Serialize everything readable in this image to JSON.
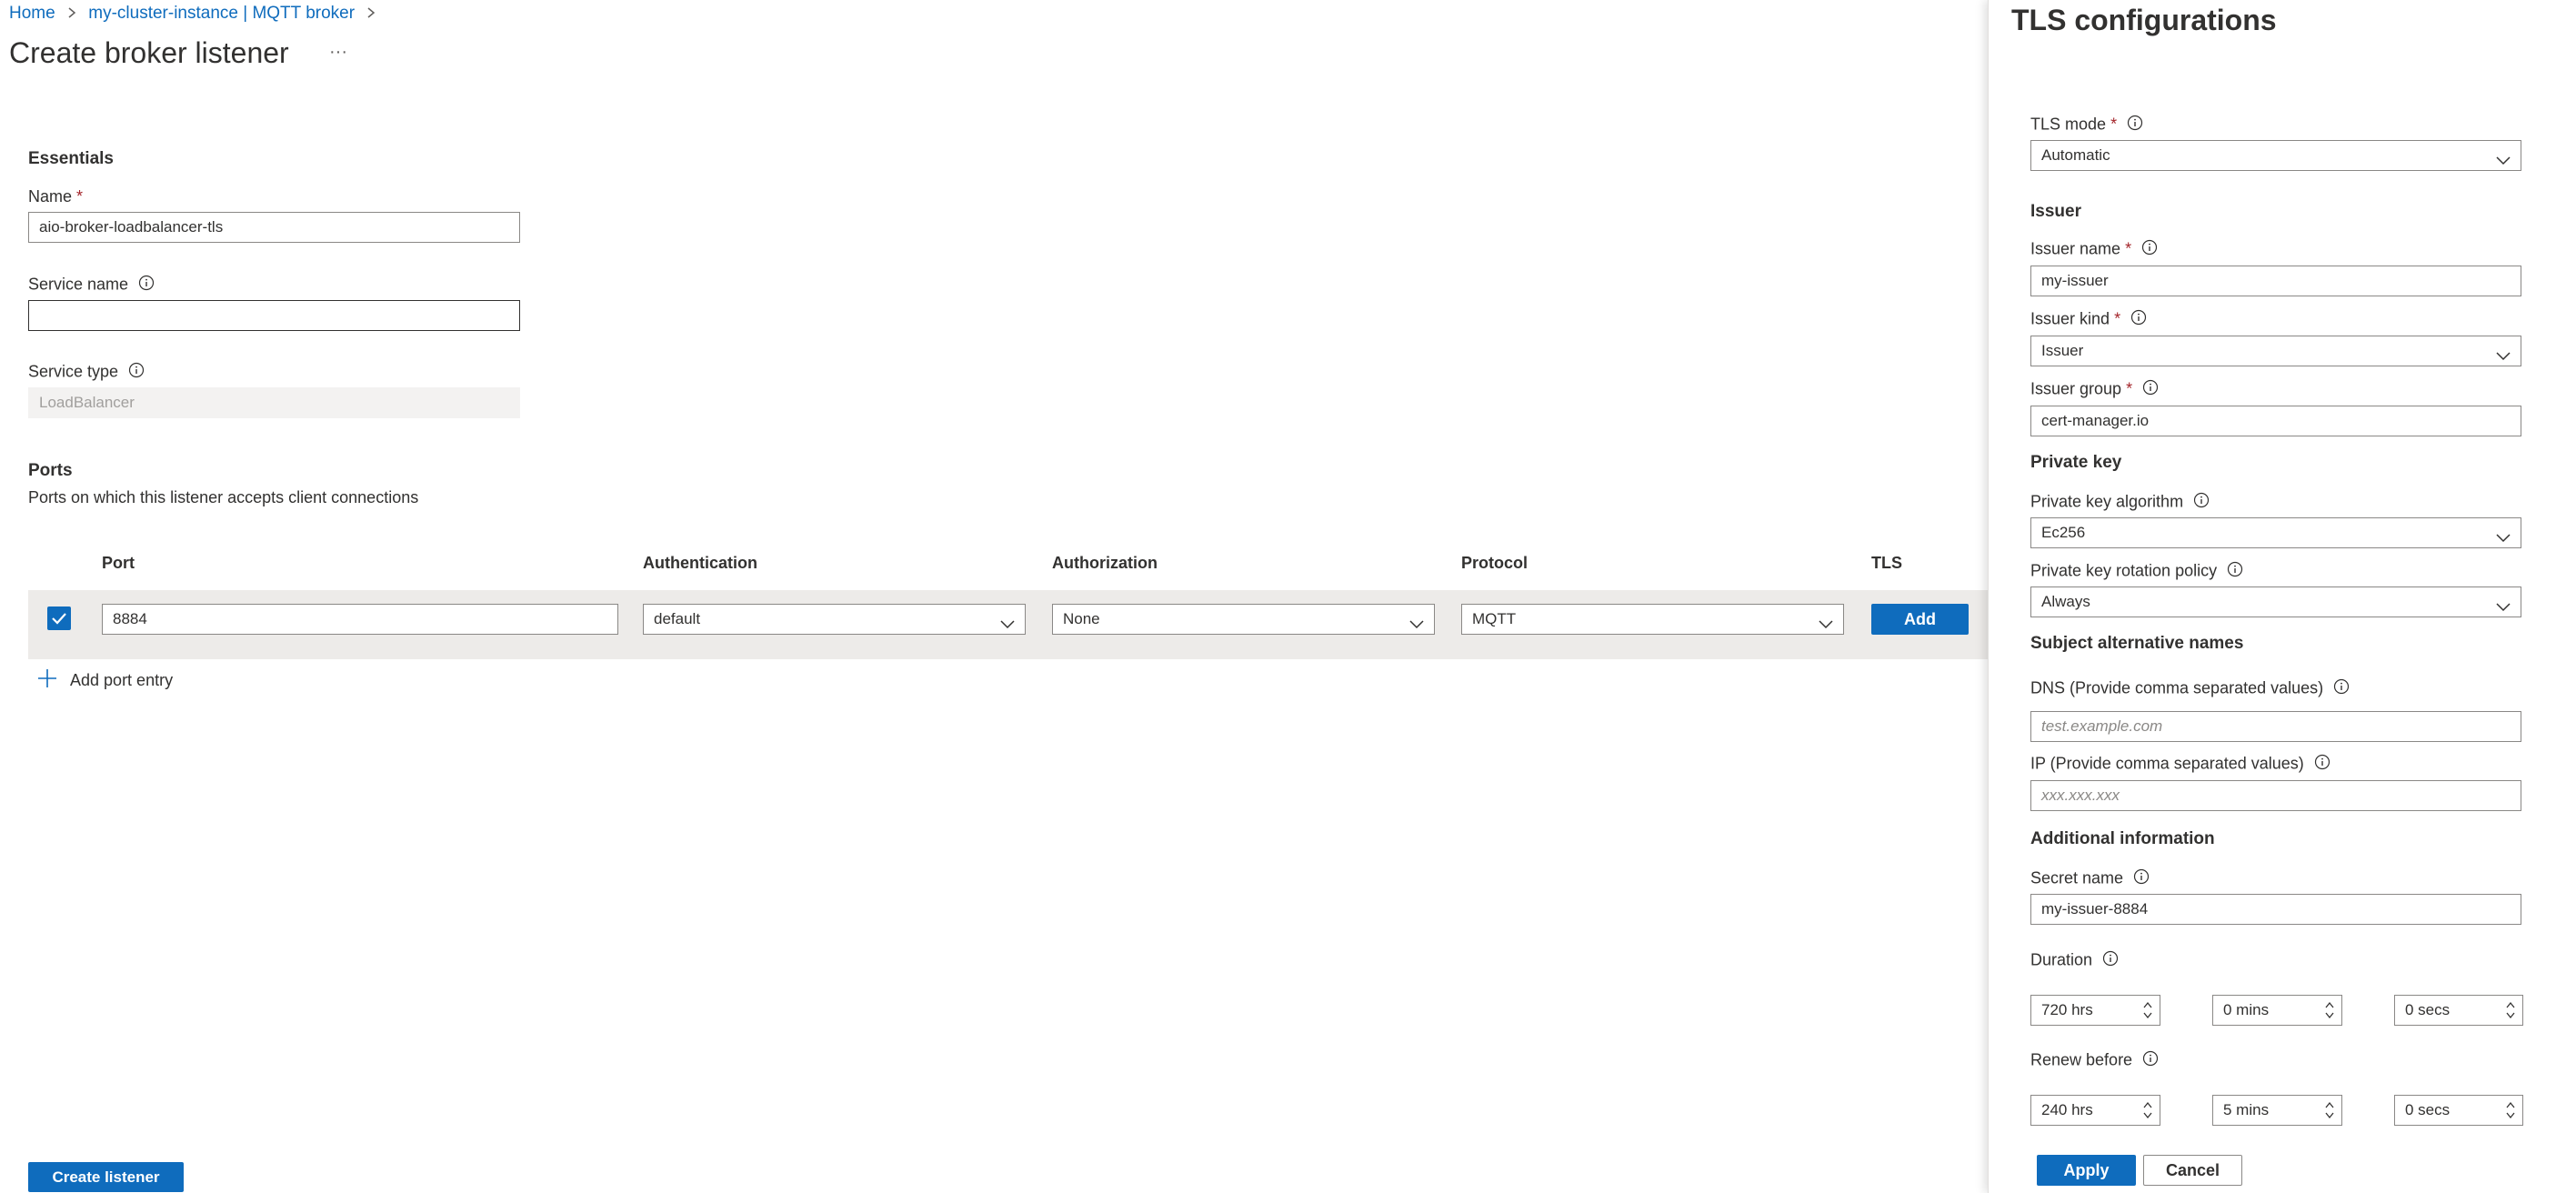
{
  "breadcrumb": {
    "home": "Home",
    "instance": "my-cluster-instance | MQTT broker"
  },
  "page": {
    "title": "Create broker listener",
    "more": "···"
  },
  "essentials": {
    "heading": "Essentials",
    "name_label": "Name",
    "name_value": "aio-broker-loadbalancer-tls",
    "service_name_label": "Service name",
    "service_name_value": "",
    "service_type_label": "Service type",
    "service_type_value": "LoadBalancer"
  },
  "ports": {
    "heading": "Ports",
    "description": "Ports on which this listener accepts client connections",
    "columns": [
      "Port",
      "Authentication",
      "Authorization",
      "Protocol",
      "TLS"
    ],
    "rows": [
      {
        "checked": true,
        "port": "8884",
        "authentication": "default",
        "authorization": "None",
        "protocol": "MQTT",
        "tls_button": "Add"
      }
    ],
    "add_entry": "Add port entry"
  },
  "footer": {
    "create_button": "Create listener"
  },
  "panel": {
    "title": "TLS configurations",
    "tls_mode_label": "TLS mode",
    "tls_mode_value": "Automatic",
    "issuer_heading": "Issuer",
    "issuer_name_label": "Issuer name",
    "issuer_name_value": "my-issuer",
    "issuer_kind_label": "Issuer kind",
    "issuer_kind_value": "Issuer",
    "issuer_group_label": "Issuer group",
    "issuer_group_value": "cert-manager.io",
    "private_key_heading": "Private key",
    "pk_algorithm_label": "Private key algorithm",
    "pk_algorithm_value": "Ec256",
    "pk_rotation_label": "Private key rotation policy",
    "pk_rotation_value": "Always",
    "san_heading": "Subject alternative names",
    "dns_label": "DNS (Provide comma separated values)",
    "dns_placeholder": "test.example.com",
    "ip_label": "IP (Provide comma separated values)",
    "ip_placeholder": "xxx.xxx.xxx",
    "additional_heading": "Additional information",
    "secret_name_label": "Secret name",
    "secret_name_value": "my-issuer-8884",
    "duration_label": "Duration",
    "duration_hrs": "720 hrs",
    "duration_mins": "0 mins",
    "duration_secs": "0 secs",
    "renew_label": "Renew before",
    "renew_hrs": "240 hrs",
    "renew_mins": "5 mins",
    "renew_secs": "0 secs",
    "apply_button": "Apply",
    "cancel_button": "Cancel"
  },
  "colors": {
    "accent": "#0f6cbd",
    "required": "#a4262c",
    "row_bg": "#edebe9"
  }
}
